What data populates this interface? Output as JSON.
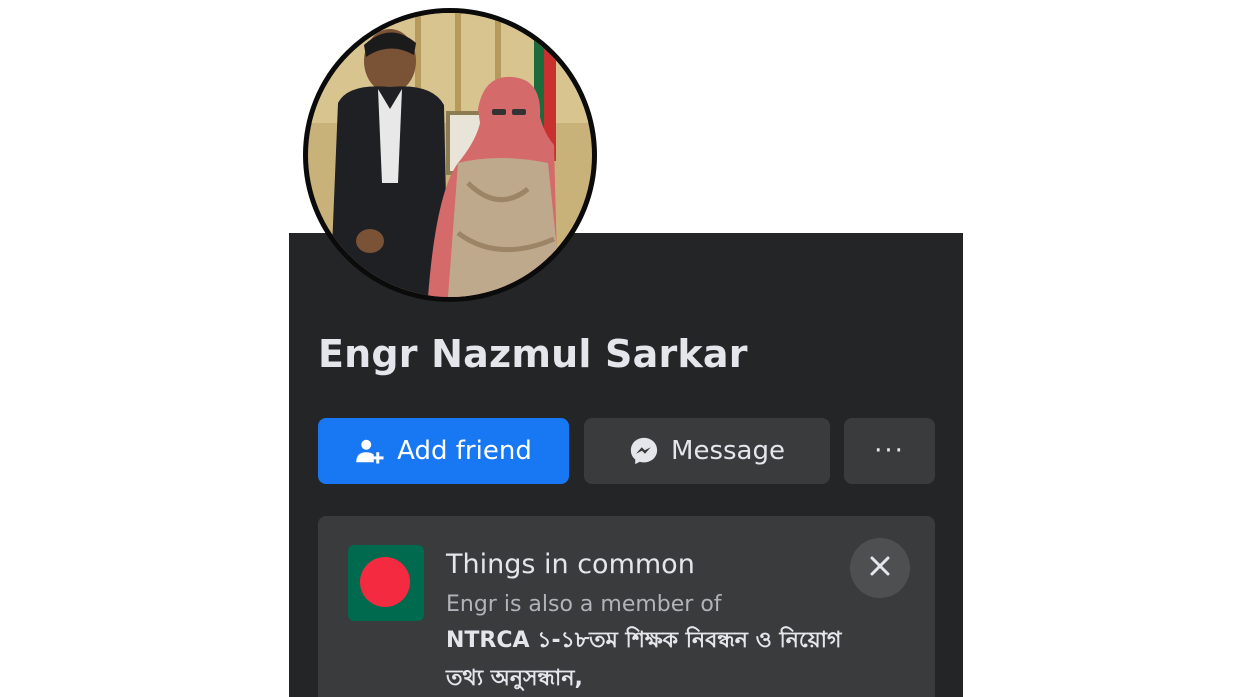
{
  "profile": {
    "name": "Engr Nazmul Sarkar",
    "avatar_icon": "profile-photo"
  },
  "actions": {
    "add_friend_label": "Add friend",
    "add_friend_icon": "add-friend-icon",
    "message_label": "Message",
    "message_icon": "messenger-icon",
    "more_label": "···"
  },
  "things_in_common": {
    "title": "Things in common",
    "subtitle": "Engr is also a member of",
    "group_name": "NTRCA ১-১৮তম শিক্ষক নিবন্ধন ও নিয়োগ তথ্য অনুসন্ধান,",
    "group_icon": "bangladesh-flag-icon",
    "close_icon": "close-icon"
  },
  "colors": {
    "panel_bg": "#242526",
    "button_blue": "#1877f2",
    "button_gray": "#3a3b3c",
    "text_primary": "#e4e6eb",
    "text_secondary": "#b0b3b8",
    "flag_green": "#006a4e",
    "flag_red": "#f42a41"
  }
}
